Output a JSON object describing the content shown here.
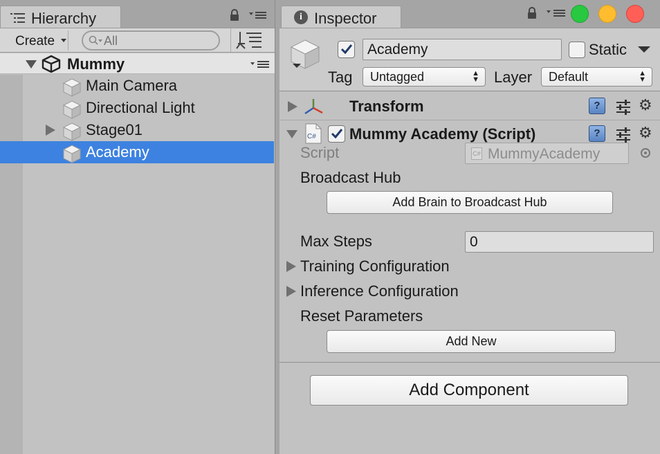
{
  "hierarchy": {
    "tab_label": "Hierarchy",
    "create_label": "Create",
    "search_placeholder": "All",
    "scene_name": "Mummy",
    "items": [
      {
        "label": "Main Camera"
      },
      {
        "label": "Directional Light"
      },
      {
        "label": "Stage01"
      },
      {
        "label": "Academy"
      }
    ]
  },
  "inspector": {
    "tab_label": "Inspector",
    "info_glyph": "i",
    "object_name": "Academy",
    "static_label": "Static",
    "tag_label": "Tag",
    "tag_value": "Untagged",
    "layer_label": "Layer",
    "layer_value": "Default",
    "transform_title": "Transform",
    "script_component_title": "Mummy Academy (Script)",
    "script_label": "Script",
    "script_value": "MummyAcademy",
    "cs_badge": "C#",
    "broadcast_hub_label": "Broadcast Hub",
    "add_brain_button": "Add Brain to Broadcast Hub",
    "max_steps_label": "Max Steps",
    "max_steps_value": "0",
    "training_config_label": "Training Configuration",
    "inference_config_label": "Inference Configuration",
    "reset_params_label": "Reset Parameters",
    "add_new_button": "Add New",
    "add_component_button": "Add Component",
    "help_glyph": "?",
    "gear_glyph": "⚙"
  },
  "colors": {
    "selection": "#3d82e0",
    "window_close": "#ff5f57",
    "window_minimize": "#febc2e",
    "window_zoom": "#28c840"
  }
}
